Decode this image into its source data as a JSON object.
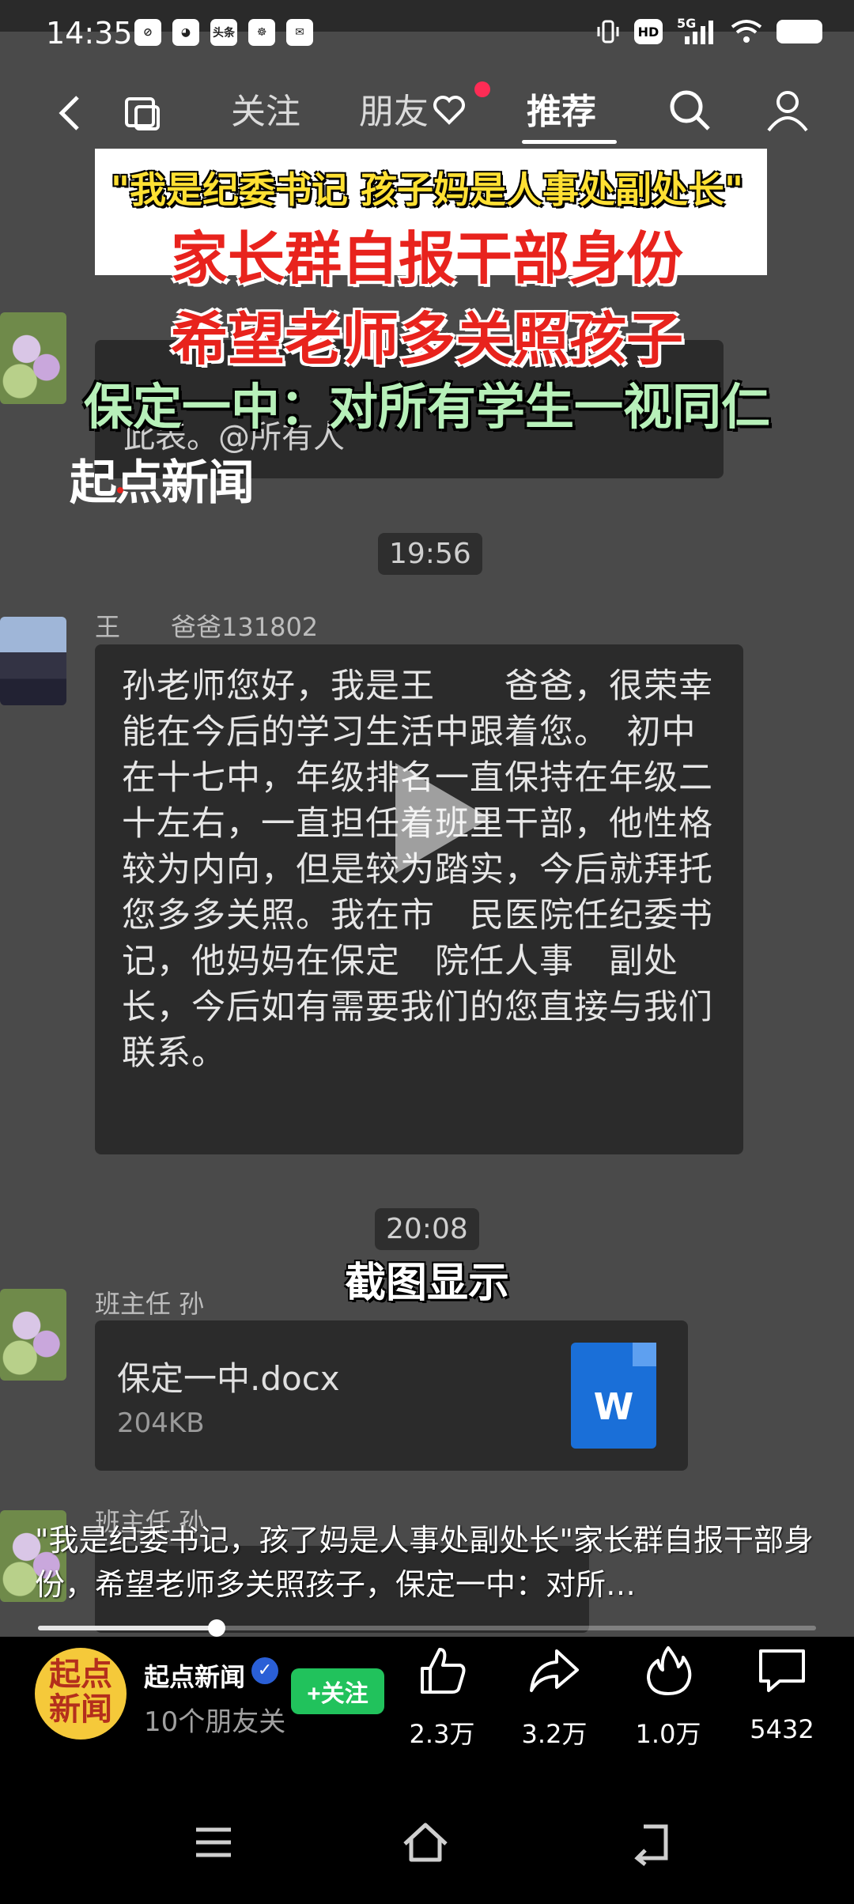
{
  "status_bar": {
    "time": "14:35",
    "left_icons": [
      "link-icon",
      "wechat-icon",
      "toutiao-icon",
      "baidu-icon",
      "mail-icon"
    ],
    "toutiao_label": "头条",
    "hd": "HD",
    "signal": "5G"
  },
  "top_nav": {
    "tabs": [
      {
        "label": "关注"
      },
      {
        "label": "朋友"
      },
      {
        "label": "推荐"
      }
    ],
    "active_tab": "推荐"
  },
  "video": {
    "headline_line1": "\"我是纪委书记 孩子妈是人事处副处长\"",
    "headline_line2": "家长群自报干部身份",
    "headline_line3": "希望老师多关照孩子",
    "headline_line4": "保定一中：对所有学生一视同仁",
    "watermark": "起点新闻",
    "first_bubble_text": "此表。@所有人",
    "time_1": "19:56",
    "sender_1": "王　　爸爸131802",
    "message": "孙老师您好，我是王　　爸爸，很荣幸　　能在今后的学习生活中跟着您。　初中在十七中，年级排名一直保持在年级二十左右，一直担任着班里干部，他性格较为内向，但是较为踏实，今后就拜托您多多关照。我在市　民医院任纪委书记，他妈妈在保定　院任人事　副处长，今后如有需要我们的您直接与我们联系。",
    "time_2": "20:08",
    "caption": "截图显示",
    "sender_2": "班主任 孙",
    "file_name": "保定一中.docx",
    "file_size": "204KB",
    "file_icon_letter": "W",
    "sender_3": "班主任 孙"
  },
  "description": "\"我是纪委书记，孩了妈是人事处副处长\"家长群自报干部身份，希望老师多关照孩子，保定一中：对所…",
  "progress": {
    "fraction": 0.23
  },
  "author": {
    "name": "起点新闻",
    "sub": "10个朋友关",
    "follow_label": "+关注",
    "avatar_text": "起点新闻"
  },
  "actions": [
    {
      "name": "like",
      "icon": "thumbs-up-icon",
      "count": "2.3万"
    },
    {
      "name": "share",
      "icon": "share-arrow-icon",
      "count": "3.2万"
    },
    {
      "name": "hot",
      "icon": "flame-icon",
      "count": "1.0万"
    },
    {
      "name": "comment",
      "icon": "comment-icon",
      "count": "5432"
    }
  ],
  "colors": {
    "headline_yellow": "#ffe033",
    "headline_red": "#e8231d",
    "headline_green": "#b7f0b9",
    "follow_green": "#21c25c",
    "word_blue": "#1a6fd8"
  }
}
